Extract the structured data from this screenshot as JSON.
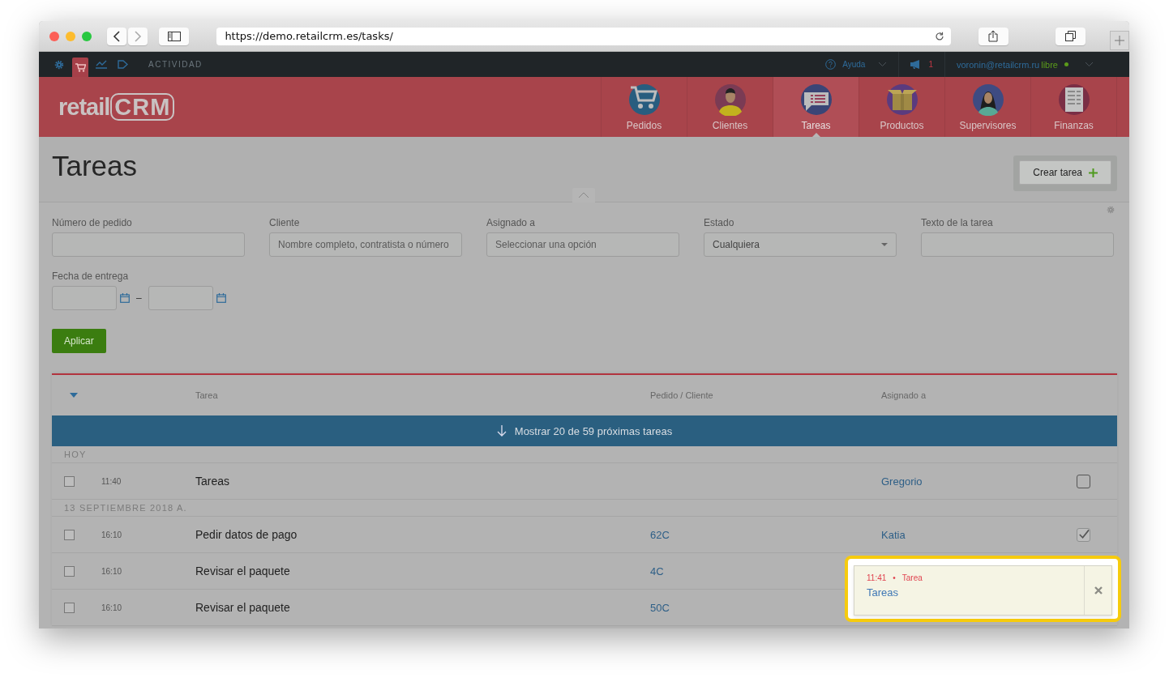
{
  "browser": {
    "url": "https://demo.retailcrm.es/tasks/"
  },
  "topbar": {
    "tools": [
      {
        "kind": "gear",
        "selected": false
      },
      {
        "kind": "cart",
        "selected": true
      },
      {
        "kind": "chart",
        "selected": false
      },
      {
        "kind": "play",
        "selected": false
      }
    ],
    "section": "ACTIVIDAD",
    "help": "Ayuda",
    "notifications": "1",
    "user": "voronin@retailcrm.ru",
    "plan": "libre"
  },
  "logo": {
    "part_1": "retail",
    "part_2": "CRM"
  },
  "nav": [
    {
      "label": "Pedidos",
      "kind": "cart",
      "selected": false
    },
    {
      "label": "Clientes",
      "kind": "man",
      "selected": false
    },
    {
      "label": "Tareas",
      "kind": "chat",
      "selected": true
    },
    {
      "label": "Productos",
      "kind": "box",
      "selected": false
    },
    {
      "label": "Supervisores",
      "kind": "woman",
      "selected": false
    },
    {
      "label": "Finanzas",
      "kind": "ledger",
      "selected": false
    }
  ],
  "page_title": "Tareas",
  "create_button": "Crear tarea",
  "filters": [
    {
      "label": "Número de pedido",
      "kind": "text"
    },
    {
      "label": "Cliente",
      "kind": "text",
      "placeholder": "Nombre completo, contratista o número"
    },
    {
      "label": "Asignado a",
      "kind": "text",
      "placeholder": "Seleccionar una opción"
    },
    {
      "label": "Estado",
      "kind": "select",
      "value": "Cualquiera"
    },
    {
      "label": "Texto de la tarea",
      "kind": "text"
    }
  ],
  "date_filter": {
    "label": "Fecha de entrega",
    "separator": "–"
  },
  "apply_button": "Aplicar",
  "table": {
    "columns": [
      "Tarea",
      "Pedido / Cliente",
      "Asignado a"
    ],
    "load_more": "Mostrar 20 de 59 próximas tareas",
    "groups": [
      {
        "title": "HOY",
        "rows": [
          {
            "time": "11:40",
            "task": "Tareas",
            "assignee": "Gregorio",
            "checked": false,
            "done": false
          }
        ]
      },
      {
        "title": "13 SEPTIEMBRE 2018 A.",
        "rows": [
          {
            "time": "16:10",
            "task": "Pedir datos de pago",
            "order": "62C",
            "assignee": "Katia",
            "checked": false,
            "done": true
          },
          {
            "time": "16:10",
            "task": "Revisar el paquete",
            "order": "4C",
            "checked": false
          },
          {
            "time": "16:10",
            "task": "Revisar el paquete",
            "order": "50C",
            "checked": false
          }
        ]
      }
    ]
  },
  "toast": {
    "time": "11:41",
    "separator": "•",
    "type": "Tarea",
    "text": "Tareas"
  }
}
